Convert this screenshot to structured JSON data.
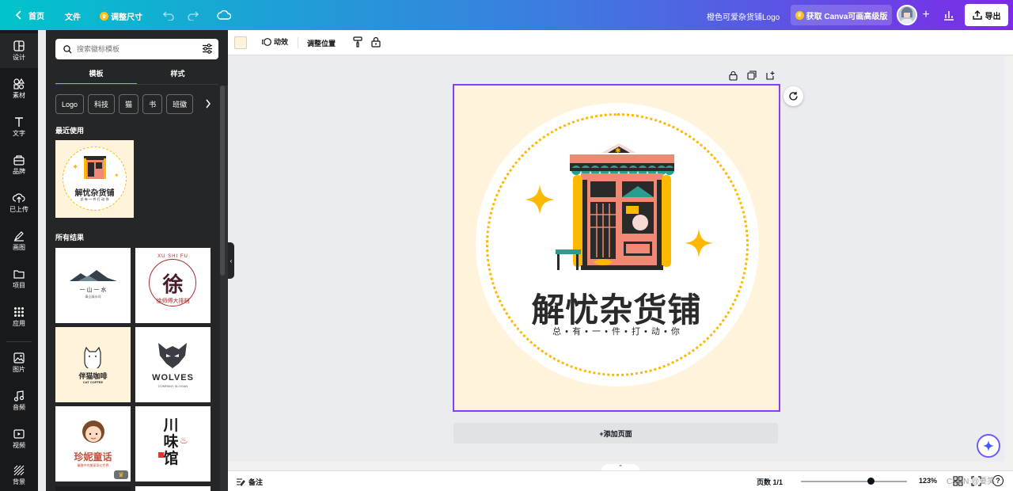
{
  "topbar": {
    "home": "首页",
    "file": "文件",
    "resize": "调整尺寸",
    "title": "橙色可爱杂货铺Logo",
    "upgrade": "获取 Canva可画高级版",
    "export": "导出"
  },
  "rail": {
    "items": [
      {
        "label": "设计",
        "icon": "design-icon"
      },
      {
        "label": "素材",
        "icon": "elements-icon"
      },
      {
        "label": "文字",
        "icon": "text-icon"
      },
      {
        "label": "品牌",
        "icon": "brand-icon"
      },
      {
        "label": "已上传",
        "icon": "upload-icon"
      },
      {
        "label": "画图",
        "icon": "draw-icon"
      },
      {
        "label": "项目",
        "icon": "folder-icon"
      },
      {
        "label": "应用",
        "icon": "apps-icon"
      },
      {
        "label": "图片",
        "icon": "image-icon"
      },
      {
        "label": "音频",
        "icon": "audio-icon"
      },
      {
        "label": "视频",
        "icon": "video-icon"
      },
      {
        "label": "背景",
        "icon": "background-icon"
      }
    ]
  },
  "panel": {
    "search_placeholder": "搜索徽标模板",
    "tabs": [
      "模板",
      "样式"
    ],
    "chips": [
      "Logo",
      "科技",
      "猫",
      "书",
      "班徽"
    ],
    "recent_title": "最近使用",
    "results_title": "所有结果",
    "recent_thumb": {
      "title": "解忧杂货铺",
      "subtitle": "总·有·一·件·打·动·你"
    },
    "results": [
      {
        "line1": "一 山 一 水",
        "line2": "青山绿水间",
        "theme": "mountain"
      },
      {
        "line1": "徐",
        "line2": "徐师傅大排档",
        "top": "XU SHI FU",
        "theme": "xu"
      },
      {
        "line1": "伴猫咖啡",
        "line2": "CAT COFFEE",
        "theme": "cat"
      },
      {
        "line1": "WOLVES",
        "line2": "COMPANY SLOGAN",
        "theme": "wolf"
      },
      {
        "line1": "珍妮童话",
        "line2": "童趣中的美丽奇幻世界",
        "theme": "girl"
      },
      {
        "line1": "川味馆",
        "line2": "",
        "theme": "sichuan"
      }
    ]
  },
  "toolbar": {
    "animate": "动效",
    "position": "调整位置",
    "bg_color": "#fff3dc"
  },
  "design": {
    "title": "解忧杂货铺",
    "subtitle": "总 • 有 • 一 • 件 • 打 • 动 • 你"
  },
  "canvas": {
    "add_page": "+添加页面"
  },
  "bottombar": {
    "notes": "备注",
    "page_count": "页数 1/1",
    "zoom": "123%",
    "zoom_level": 0.66,
    "watermark": "CSDN @要笑"
  },
  "colors": {
    "brand_purple": "#8b3dff",
    "accent_yellow": "#ffb800",
    "shop_red": "#f08873",
    "dark": "#2a2a2a"
  }
}
